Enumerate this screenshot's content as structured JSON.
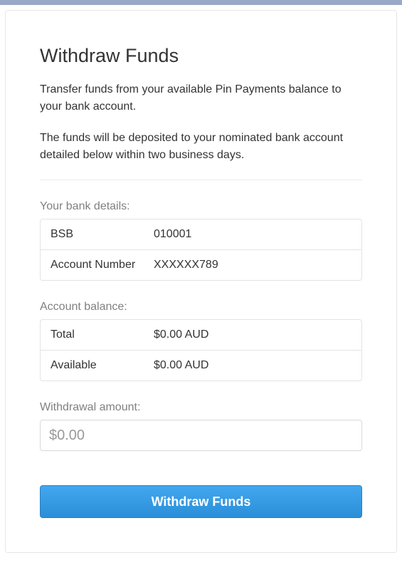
{
  "header": {
    "title": "Withdraw Funds"
  },
  "description": {
    "para1": "Transfer funds from your available Pin Payments balance to your bank account.",
    "para2": "The funds will be deposited to your nominated bank account detailed below within two business days."
  },
  "bank_details": {
    "label": "Your bank details:",
    "rows": [
      {
        "key": "BSB",
        "value": "010001"
      },
      {
        "key": "Account Number",
        "value": "XXXXXX789"
      }
    ]
  },
  "account_balance": {
    "label": "Account balance:",
    "rows": [
      {
        "key": "Total",
        "value": "$0.00 AUD"
      },
      {
        "key": "Available",
        "value": "$0.00 AUD"
      }
    ]
  },
  "withdrawal": {
    "label": "Withdrawal amount:",
    "placeholder": "$0.00",
    "value": ""
  },
  "actions": {
    "withdraw_label": "Withdraw Funds"
  }
}
